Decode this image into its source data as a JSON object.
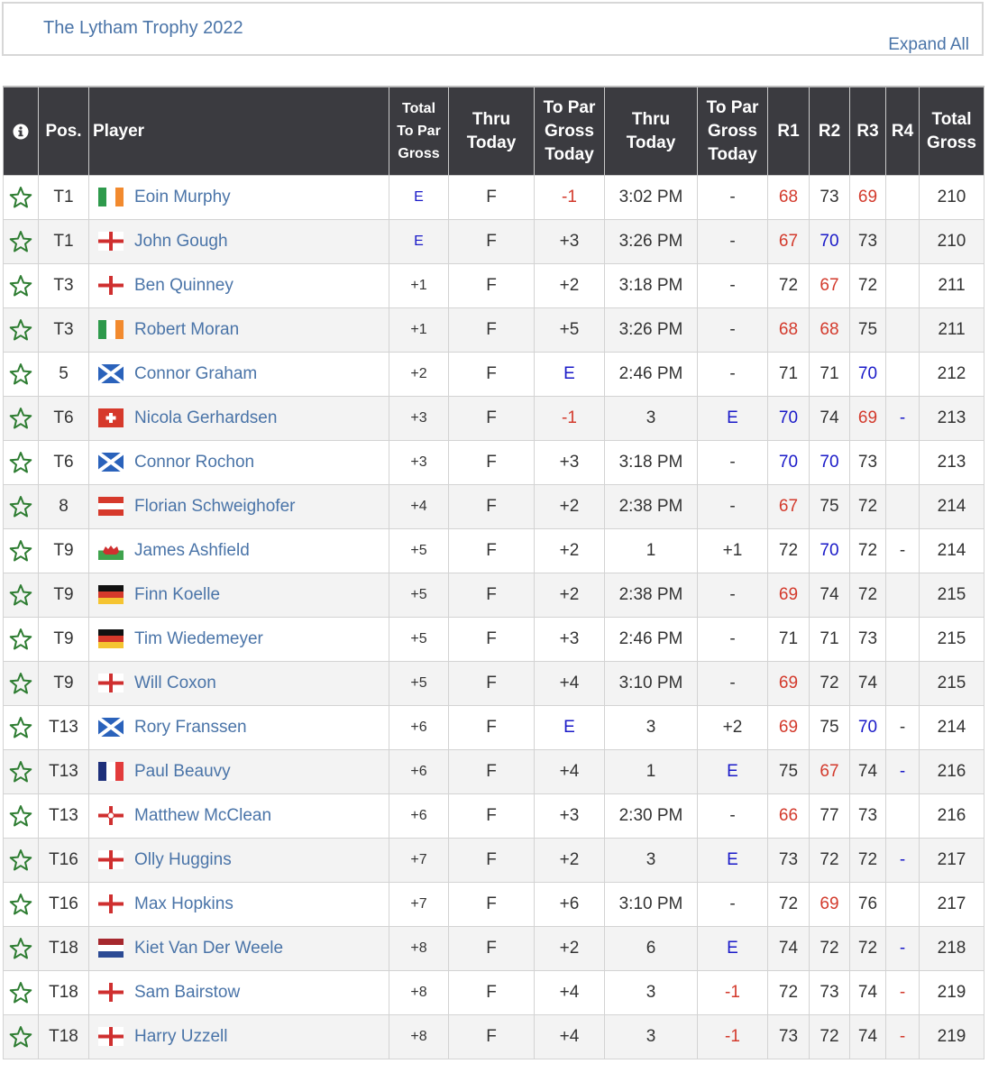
{
  "header": {
    "title": "The Lytham Trophy 2022",
    "expand_label": "Expand All"
  },
  "colors": {
    "link": "#4a74a8",
    "under_par": "#d33a2c",
    "even_par": "#1a1ac8",
    "header_bg": "#3b3b40",
    "star": "#2e7d32"
  },
  "columns": {
    "info": "info-icon",
    "pos": "Pos.",
    "player": "Player",
    "total_to_par": [
      "Total",
      "To Par",
      "Gross"
    ],
    "thru": [
      "Thru",
      "Today"
    ],
    "to_par_today": [
      "To Par",
      "Gross",
      "Today"
    ],
    "thru2": [
      "Thru",
      "Today"
    ],
    "to_par_today2": [
      "To Par",
      "Gross",
      "Today"
    ],
    "r1": "R1",
    "r2": "R2",
    "r3": "R3",
    "r4": "R4",
    "total_gross": [
      "Total",
      "Gross"
    ]
  },
  "rows": [
    {
      "pos": "T1",
      "flag": "ireland",
      "player": "Eoin Murphy",
      "total": "E",
      "thru": "F",
      "topar": "-1",
      "thru2": "3:02 PM",
      "topar2": "-",
      "r1": "68",
      "r2": "73",
      "r3": "69",
      "r4": "",
      "gross": "210"
    },
    {
      "pos": "T1",
      "flag": "england",
      "player": "John Gough",
      "total": "E",
      "thru": "F",
      "topar": "+3",
      "thru2": "3:26 PM",
      "topar2": "-",
      "r1": "67",
      "r2": "70",
      "r3": "73",
      "r4": "",
      "gross": "210"
    },
    {
      "pos": "T3",
      "flag": "england",
      "player": "Ben Quinney",
      "total": "+1",
      "thru": "F",
      "topar": "+2",
      "thru2": "3:18 PM",
      "topar2": "-",
      "r1": "72",
      "r2": "67",
      "r3": "72",
      "r4": "",
      "gross": "211"
    },
    {
      "pos": "T3",
      "flag": "ireland",
      "player": "Robert Moran",
      "total": "+1",
      "thru": "F",
      "topar": "+5",
      "thru2": "3:26 PM",
      "topar2": "-",
      "r1": "68",
      "r2": "68",
      "r3": "75",
      "r4": "",
      "gross": "211"
    },
    {
      "pos": "5",
      "flag": "scotland",
      "player": "Connor Graham",
      "total": "+2",
      "thru": "F",
      "topar": "E",
      "thru2": "2:46 PM",
      "topar2": "-",
      "r1": "71",
      "r2": "71",
      "r3": "70",
      "r4": "",
      "gross": "212"
    },
    {
      "pos": "T6",
      "flag": "switzerland",
      "player": "Nicola Gerhardsen",
      "total": "+3",
      "thru": "F",
      "topar": "-1",
      "thru2": "3",
      "topar2": "E",
      "r1": "70",
      "r2": "74",
      "r3": "69",
      "r4": "-",
      "gross": "213"
    },
    {
      "pos": "T6",
      "flag": "scotland",
      "player": "Connor Rochon",
      "total": "+3",
      "thru": "F",
      "topar": "+3",
      "thru2": "3:18 PM",
      "topar2": "-",
      "r1": "70",
      "r2": "70",
      "r3": "73",
      "r4": "",
      "gross": "213"
    },
    {
      "pos": "8",
      "flag": "austria",
      "player": "Florian Schweighofer",
      "total": "+4",
      "thru": "F",
      "topar": "+2",
      "thru2": "2:38 PM",
      "topar2": "-",
      "r1": "67",
      "r2": "75",
      "r3": "72",
      "r4": "",
      "gross": "214"
    },
    {
      "pos": "T9",
      "flag": "wales",
      "player": "James Ashfield",
      "total": "+5",
      "thru": "F",
      "topar": "+2",
      "thru2": "1",
      "topar2": "+1",
      "r1": "72",
      "r2": "70",
      "r3": "72",
      "r4": "-",
      "gross": "214"
    },
    {
      "pos": "T9",
      "flag": "germany",
      "player": "Finn Koelle",
      "total": "+5",
      "thru": "F",
      "topar": "+2",
      "thru2": "2:38 PM",
      "topar2": "-",
      "r1": "69",
      "r2": "74",
      "r3": "72",
      "r4": "",
      "gross": "215"
    },
    {
      "pos": "T9",
      "flag": "germany",
      "player": "Tim Wiedemeyer",
      "total": "+5",
      "thru": "F",
      "topar": "+3",
      "thru2": "2:46 PM",
      "topar2": "-",
      "r1": "71",
      "r2": "71",
      "r3": "73",
      "r4": "",
      "gross": "215"
    },
    {
      "pos": "T9",
      "flag": "england",
      "player": "Will Coxon",
      "total": "+5",
      "thru": "F",
      "topar": "+4",
      "thru2": "3:10 PM",
      "topar2": "-",
      "r1": "69",
      "r2": "72",
      "r3": "74",
      "r4": "",
      "gross": "215"
    },
    {
      "pos": "T13",
      "flag": "scotland",
      "player": "Rory Franssen",
      "total": "+6",
      "thru": "F",
      "topar": "E",
      "thru2": "3",
      "topar2": "+2",
      "r1": "69",
      "r2": "75",
      "r3": "70",
      "r4": "-",
      "gross": "214"
    },
    {
      "pos": "T13",
      "flag": "france",
      "player": "Paul Beauvy",
      "total": "+6",
      "thru": "F",
      "topar": "+4",
      "thru2": "1",
      "topar2": "E",
      "r1": "75",
      "r2": "67",
      "r3": "74",
      "r4": "-",
      "gross": "216"
    },
    {
      "pos": "T13",
      "flag": "northern-ireland",
      "player": "Matthew McClean",
      "total": "+6",
      "thru": "F",
      "topar": "+3",
      "thru2": "2:30 PM",
      "topar2": "-",
      "r1": "66",
      "r2": "77",
      "r3": "73",
      "r4": "",
      "gross": "216"
    },
    {
      "pos": "T16",
      "flag": "england",
      "player": "Olly Huggins",
      "total": "+7",
      "thru": "F",
      "topar": "+2",
      "thru2": "3",
      "topar2": "E",
      "r1": "73",
      "r2": "72",
      "r3": "72",
      "r4": "-",
      "gross": "217"
    },
    {
      "pos": "T16",
      "flag": "england",
      "player": "Max Hopkins",
      "total": "+7",
      "thru": "F",
      "topar": "+6",
      "thru2": "3:10 PM",
      "topar2": "-",
      "r1": "72",
      "r2": "69",
      "r3": "76",
      "r4": "",
      "gross": "217"
    },
    {
      "pos": "T18",
      "flag": "netherlands",
      "player": "Kiet Van Der Weele",
      "total": "+8",
      "thru": "F",
      "topar": "+2",
      "thru2": "6",
      "topar2": "E",
      "r1": "74",
      "r2": "72",
      "r3": "72",
      "r4": "-",
      "gross": "218"
    },
    {
      "pos": "T18",
      "flag": "england",
      "player": "Sam Bairstow",
      "total": "+8",
      "thru": "F",
      "topar": "+4",
      "thru2": "3",
      "topar2": "-1",
      "r1": "72",
      "r2": "73",
      "r3": "74",
      "r4": "-",
      "gross": "219"
    },
    {
      "pos": "T18",
      "flag": "england",
      "player": "Harry Uzzell",
      "total": "+8",
      "thru": "F",
      "topar": "+4",
      "thru2": "3",
      "topar2": "-1",
      "r1": "73",
      "r2": "72",
      "r3": "74",
      "r4": "-",
      "gross": "219"
    }
  ],
  "round_colors": {
    "note": "per-row color class for r1..r4 and par cells",
    "map": [
      {
        "total": "blue",
        "topar": "red",
        "topar2": "",
        "r1": "red",
        "r2": "",
        "r3": "red",
        "r4": ""
      },
      {
        "total": "blue",
        "topar": "",
        "topar2": "",
        "r1": "red",
        "r2": "blue",
        "r3": "",
        "r4": ""
      },
      {
        "total": "",
        "topar": "",
        "topar2": "",
        "r1": "",
        "r2": "red",
        "r3": "",
        "r4": ""
      },
      {
        "total": "",
        "topar": "",
        "topar2": "",
        "r1": "red",
        "r2": "red",
        "r3": "",
        "r4": ""
      },
      {
        "total": "",
        "topar": "blue",
        "topar2": "",
        "r1": "",
        "r2": "",
        "r3": "blue",
        "r4": ""
      },
      {
        "total": "",
        "topar": "red",
        "topar2": "blue",
        "r1": "blue",
        "r2": "",
        "r3": "red",
        "r4": "blue"
      },
      {
        "total": "",
        "topar": "",
        "topar2": "",
        "r1": "blue",
        "r2": "blue",
        "r3": "",
        "r4": ""
      },
      {
        "total": "",
        "topar": "",
        "topar2": "",
        "r1": "red",
        "r2": "",
        "r3": "",
        "r4": ""
      },
      {
        "total": "",
        "topar": "",
        "topar2": "",
        "r1": "",
        "r2": "blue",
        "r3": "",
        "r4": ""
      },
      {
        "total": "",
        "topar": "",
        "topar2": "",
        "r1": "red",
        "r2": "",
        "r3": "",
        "r4": ""
      },
      {
        "total": "",
        "topar": "",
        "topar2": "",
        "r1": "",
        "r2": "",
        "r3": "",
        "r4": ""
      },
      {
        "total": "",
        "topar": "",
        "topar2": "",
        "r1": "red",
        "r2": "",
        "r3": "",
        "r4": ""
      },
      {
        "total": "",
        "topar": "blue",
        "topar2": "",
        "r1": "red",
        "r2": "",
        "r3": "blue",
        "r4": ""
      },
      {
        "total": "",
        "topar": "",
        "topar2": "blue",
        "r1": "",
        "r2": "red",
        "r3": "",
        "r4": "blue"
      },
      {
        "total": "",
        "topar": "",
        "topar2": "",
        "r1": "red",
        "r2": "",
        "r3": "",
        "r4": ""
      },
      {
        "total": "",
        "topar": "",
        "topar2": "blue",
        "r1": "",
        "r2": "",
        "r3": "",
        "r4": "blue"
      },
      {
        "total": "",
        "topar": "",
        "topar2": "",
        "r1": "",
        "r2": "red",
        "r3": "",
        "r4": ""
      },
      {
        "total": "",
        "topar": "",
        "topar2": "blue",
        "r1": "",
        "r2": "",
        "r3": "",
        "r4": "blue"
      },
      {
        "total": "",
        "topar": "",
        "topar2": "red",
        "r1": "",
        "r2": "",
        "r3": "",
        "r4": "red"
      },
      {
        "total": "",
        "topar": "",
        "topar2": "red",
        "r1": "",
        "r2": "",
        "r3": "",
        "r4": "red"
      }
    ]
  }
}
